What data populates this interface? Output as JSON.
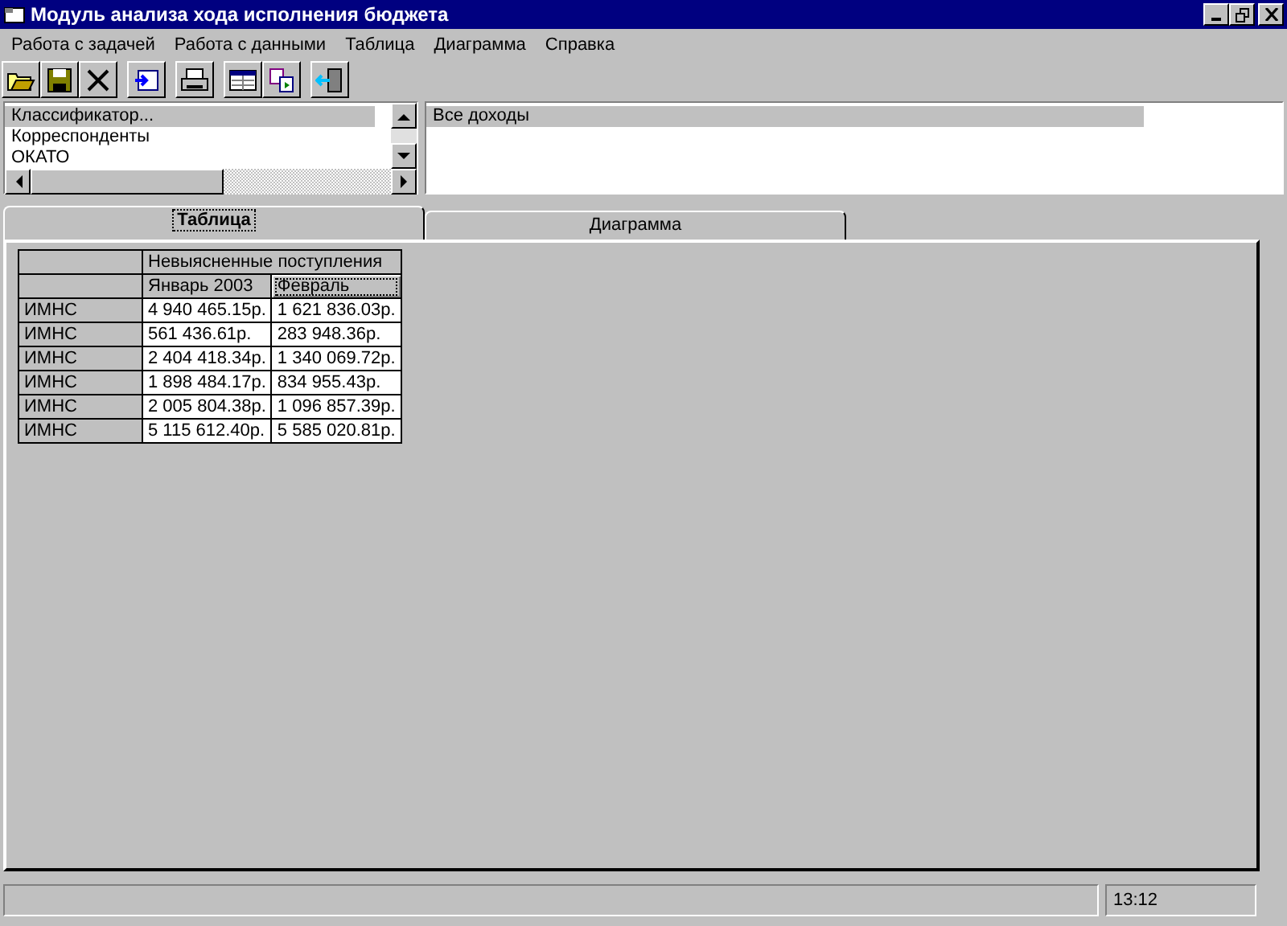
{
  "window": {
    "title": "Модуль анализа хода исполнения бюджета"
  },
  "menu": [
    "Работа с задачей",
    "Работа с данными",
    "Таблица",
    "Диаграмма",
    "Справка"
  ],
  "classifier_list": {
    "items": [
      {
        "label": "Классификатор...",
        "selected": true
      },
      {
        "label": "Корреспонденты",
        "selected": false
      },
      {
        "label": "ОКАТО",
        "selected": false
      }
    ]
  },
  "income_list": {
    "items": [
      {
        "label": "Все доходы",
        "selected": true
      }
    ]
  },
  "tabs": [
    {
      "label": "Таблица",
      "selected": true
    },
    {
      "label": "Диаграмма",
      "selected": false
    }
  ],
  "table": {
    "group_header": "Невыясненные поступления",
    "columns": [
      {
        "focused": false
      },
      {
        "label": "Январь 2003",
        "focused": false
      },
      {
        "label": "Февраль",
        "focused": true
      }
    ],
    "rows": [
      [
        "ИМНС",
        "4 940 465.15р.",
        "1 621 836.03р."
      ],
      [
        "ИМНС",
        "561 436.61р.",
        "283 948.36р."
      ],
      [
        "ИМНС",
        "2 404 418.34р.",
        "1 340 069.72р."
      ],
      [
        "ИМНС",
        "1 898 484.17р.",
        "834 955.43р."
      ],
      [
        "ИМНС",
        "2 005 804.38р.",
        "1 096 857.39р."
      ],
      [
        "ИМНС",
        "5 115 612.40р.",
        "5 585 020.81р."
      ]
    ]
  },
  "status_bar": {
    "time": "13:12"
  }
}
